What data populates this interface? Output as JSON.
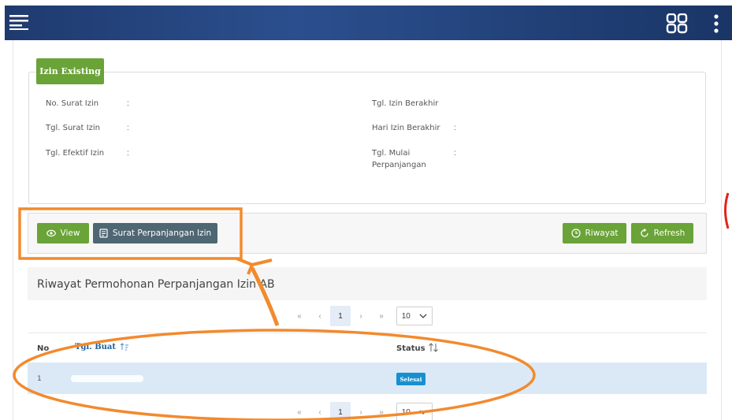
{
  "colors": {
    "topbar": "#1f3a6e",
    "green": "#6aa338",
    "gray": "#4f6673",
    "badge": "#1890d0",
    "annotation": "#f28a2e"
  },
  "icons": [
    "menu-icon",
    "grid-icon",
    "kebab-icon",
    "eye-icon",
    "document-icon",
    "clock-icon",
    "refresh-icon",
    "sort-icon",
    "chevron-down-icon"
  ],
  "tab": {
    "label": "Izin Existing"
  },
  "info": {
    "no_surat": "No. Surat Izin",
    "tgl_surat": "Tgl. Surat Izin",
    "tgl_efektif": "Tgl. Efektif Izin",
    "tgl_berakhir": "Tgl. Izin Berakhir",
    "hari_berakhir": "Hari Izin Berakhir",
    "tgl_mulai_1": "Tgl. Mulai",
    "tgl_mulai_2": "Perpanjangan",
    "colon": ":"
  },
  "buttons": {
    "view": "View",
    "surat": "Surat Perpanjangan Izin",
    "riwayat": "Riwayat",
    "refresh": "Refresh"
  },
  "table": {
    "title": "Riwayat Permohonan Perpanjangan Izin AB",
    "col_no": "No",
    "col_tgl": "Tgl. Buat",
    "col_status": "Status",
    "rows": [
      {
        "no": "1",
        "status": "Selesai"
      }
    ]
  },
  "pager": {
    "first": "«",
    "prev": "‹",
    "page": "1",
    "next": "›",
    "last": "»",
    "page_size": "10"
  }
}
